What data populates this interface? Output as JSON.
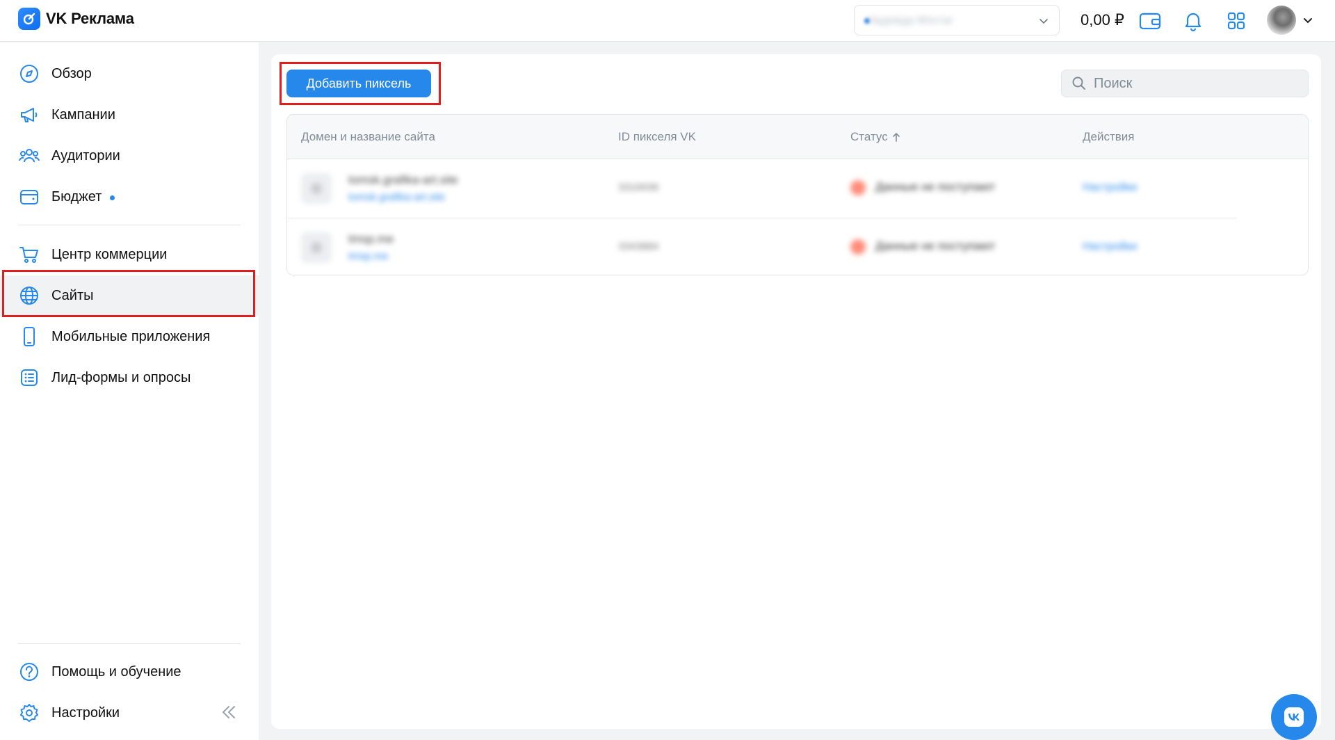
{
  "app": {
    "title": "VK Реклама"
  },
  "header": {
    "account_name": "Надежда Мостаг",
    "balance": "0,00 ₽"
  },
  "sidebar": {
    "items": [
      {
        "label": "Обзор",
        "icon": "compass-icon"
      },
      {
        "label": "Кампании",
        "icon": "megaphone-icon"
      },
      {
        "label": "Аудитории",
        "icon": "users-icon"
      },
      {
        "label": "Бюджет",
        "icon": "wallet-icon",
        "has_badge": true
      },
      {
        "label": "Центр коммерции",
        "icon": "cart-icon"
      },
      {
        "label": "Сайты",
        "icon": "globe-icon",
        "active": true
      },
      {
        "label": "Мобильные приложения",
        "icon": "phone-icon"
      },
      {
        "label": "Лид-формы и опросы",
        "icon": "list-icon"
      }
    ],
    "bottom": [
      {
        "label": "Помощь и обучение",
        "icon": "help-icon"
      },
      {
        "label": "Настройки",
        "icon": "gear-icon"
      }
    ]
  },
  "toolbar": {
    "add_pixel_label": "Добавить пиксель",
    "search_placeholder": "Поиск"
  },
  "table": {
    "columns": [
      "Домен и название сайта",
      "ID пикселя VK",
      "Статус",
      "Действия"
    ],
    "rows": [
      {
        "title": "tomsk.grafika-art.site",
        "link": "tomsk.grafika-art.site",
        "pixel_id": "3316936",
        "status": "Данные не поступают",
        "action": "Настройки"
      },
      {
        "title": "tmsp.me",
        "link": "tmsp.me",
        "pixel_id": "3343884",
        "status": "Данные не поступают",
        "action": "Настройки"
      }
    ]
  },
  "colors": {
    "accent": "#2688eb",
    "highlight": "#e01e1e",
    "status_error": "#ff8c7a"
  }
}
